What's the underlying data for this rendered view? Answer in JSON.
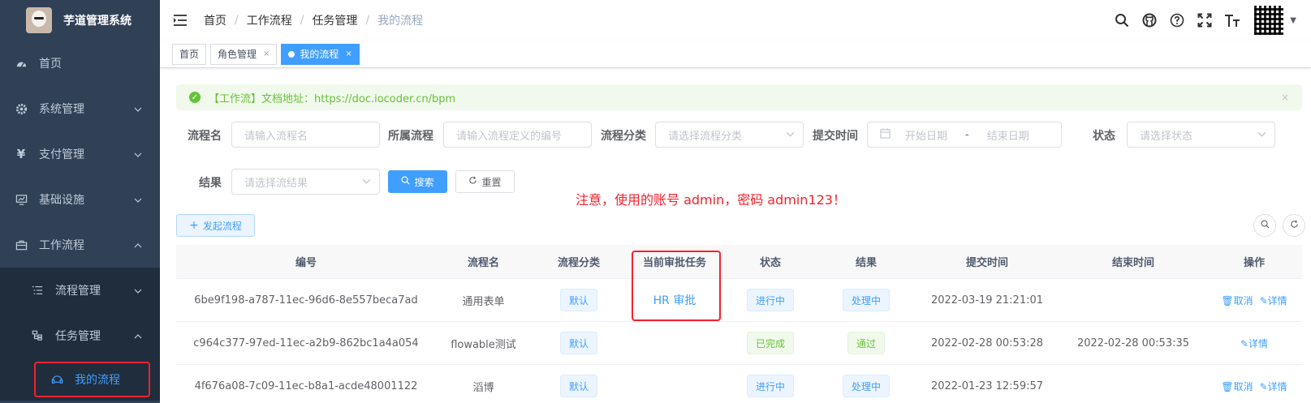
{
  "sidebar": {
    "title": "芋道管理系统",
    "items": [
      {
        "label": "首页",
        "icon": "dashboard-icon"
      },
      {
        "label": "系统管理",
        "icon": "gear-icon"
      },
      {
        "label": "支付管理",
        "icon": "yen-icon"
      },
      {
        "label": "基础设施",
        "icon": "monitor-icon"
      },
      {
        "label": "工作流程",
        "icon": "toolbox-icon"
      }
    ],
    "sub_items": [
      {
        "label": "流程管理",
        "icon": "list-icon"
      },
      {
        "label": "任务管理",
        "icon": "tree-icon"
      }
    ],
    "active_item": {
      "label": "我的流程",
      "icon": "robot-icon"
    }
  },
  "navbar": {
    "breadcrumb": [
      "首页",
      "工作流程",
      "任务管理",
      "我的流程"
    ],
    "icons": [
      "search-icon",
      "github-icon",
      "question-icon",
      "fullscreen-icon",
      "font-size-icon"
    ]
  },
  "tags": [
    {
      "label": "首页",
      "closable": false,
      "active": false
    },
    {
      "label": "角色管理",
      "closable": true,
      "active": false
    },
    {
      "label": "我的流程",
      "closable": true,
      "active": true
    }
  ],
  "tag_close": "×",
  "alert": {
    "text": "【工作流】文档地址：https://doc.iocoder.cn/bpm",
    "close": "×"
  },
  "search": {
    "name_label": "流程名",
    "name_placeholder": "请输入流程名",
    "definition_label": "所属流程",
    "definition_placeholder": "请输入流程定义的编号",
    "category_label": "流程分类",
    "category_placeholder": "请选择流程分类",
    "time_label": "提交时间",
    "start_placeholder": "开始日期",
    "range_sep": "-",
    "end_placeholder": "结束日期",
    "status_label": "状态",
    "status_placeholder": "请选择状态",
    "result_label": "结果",
    "result_placeholder": "请选择流结果",
    "search_button": "搜索",
    "reset_button": "重置"
  },
  "notice": "注意，使用的账号 admin，密码 admin123！",
  "toolbar": {
    "add_button": "发起流程"
  },
  "table": {
    "columns": [
      "编号",
      "流程名",
      "流程分类",
      "当前审批任务",
      "状态",
      "结果",
      "提交时间",
      "结束时间",
      "操作"
    ],
    "rows": [
      {
        "id": "6be9f198-a787-11ec-96d6-8e557beca7ad",
        "name": "通用表单",
        "category": "默认",
        "task": "HR 审批",
        "status": "进行中",
        "result": "处理中",
        "submit_time": "2022-03-19 21:21:01",
        "end_time": "",
        "actions": [
          "取消",
          "详情"
        ]
      },
      {
        "id": "c964c377-97ed-11ec-a2b9-862bc1a4a054",
        "name": "flowable测试",
        "category": "默认",
        "task": "",
        "status": "已完成",
        "result": "通过",
        "submit_time": "2022-02-28 00:53:28",
        "end_time": "2022-02-28 00:53:35",
        "actions": [
          "详情"
        ]
      },
      {
        "id": "4f676a08-7c09-11ec-b8a1-acde48001122",
        "name": "滔博",
        "category": "默认",
        "task": "",
        "status": "进行中",
        "result": "处理中",
        "submit_time": "2022-01-23 12:59:57",
        "end_time": "",
        "actions": [
          "取消",
          "详情"
        ]
      }
    ]
  },
  "colors": {
    "primary": "#409eff",
    "success": "#67c23a",
    "sidebar_bg": "#304156",
    "highlight": "#f5222d"
  }
}
